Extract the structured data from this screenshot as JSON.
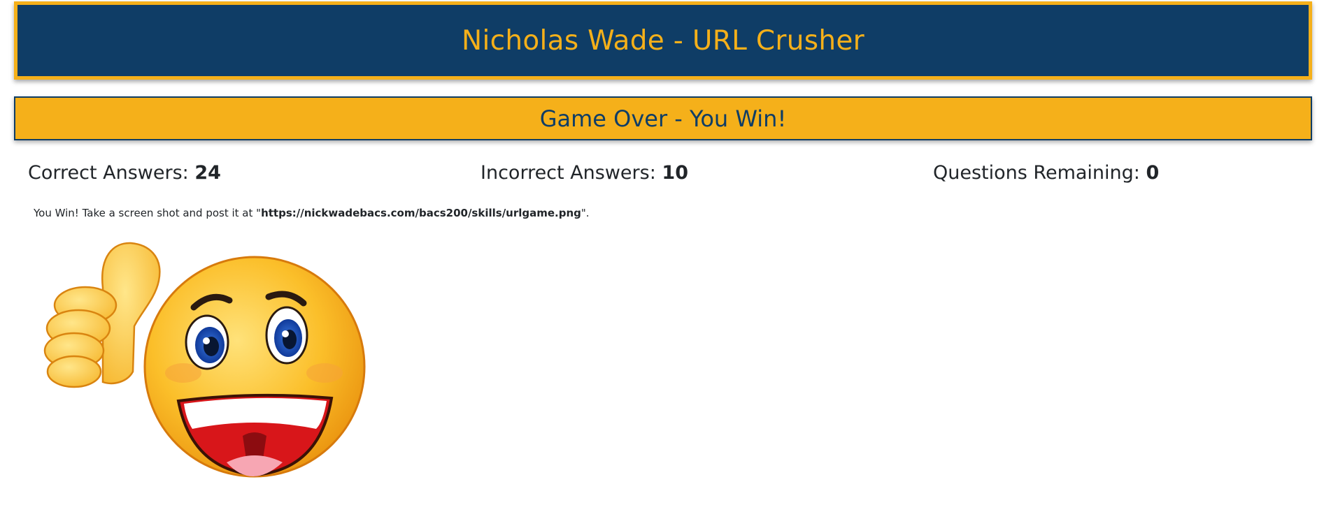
{
  "header": {
    "title": "Nicholas Wade - URL Crusher"
  },
  "banner": {
    "status": "Game Over - You Win!"
  },
  "stats": {
    "correct_label": "Correct Answers:",
    "correct_value": "24",
    "incorrect_label": "Incorrect Answers:",
    "incorrect_value": "10",
    "remaining_label": "Questions Remaining:",
    "remaining_value": "0"
  },
  "message": {
    "prefix": "You Win! Take a screen shot and post it at \"",
    "url": "https://nickwadebacs.com/bacs200/skills/urlgame.png",
    "suffix": "\"."
  },
  "colors": {
    "navy": "#0f3d66",
    "gold": "#f5b01a"
  },
  "image": {
    "icon": "thumbs-up-smiley-icon"
  }
}
